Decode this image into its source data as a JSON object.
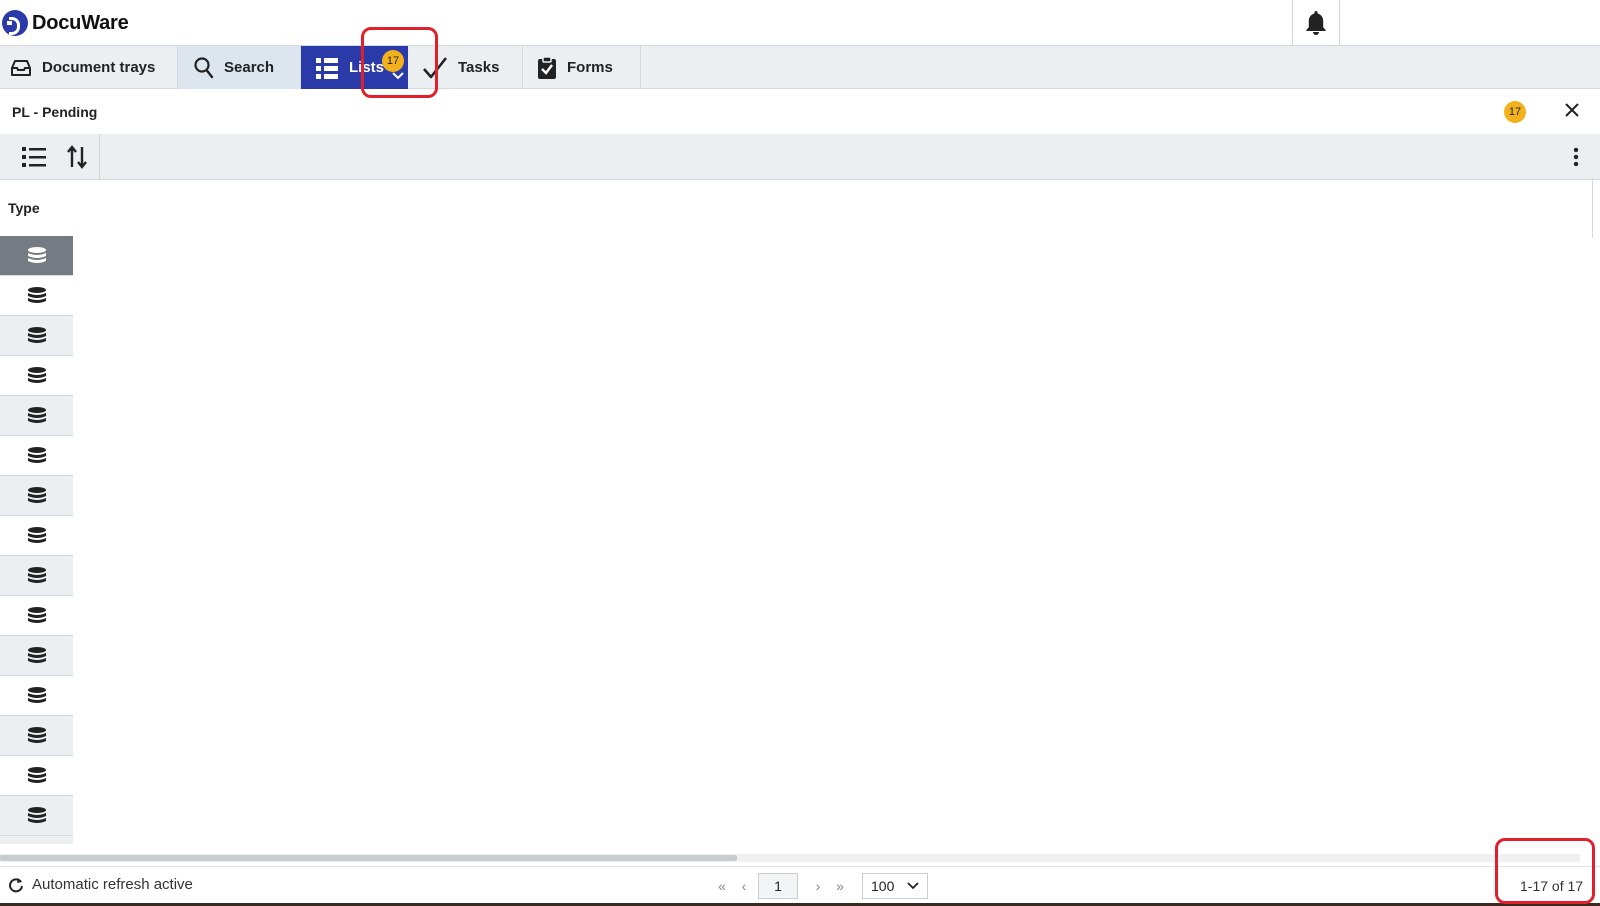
{
  "app": {
    "logo_text": "DocuWare"
  },
  "header": {
    "bell_icon": "bell-icon"
  },
  "nav": {
    "items": [
      {
        "label": "Document trays",
        "icon": "inbox-tray-icon"
      },
      {
        "label": "Search",
        "icon": "search-icon"
      },
      {
        "label": "Lists",
        "icon": "list-grid-icon",
        "badge": "17",
        "active": true
      },
      {
        "label": "Tasks",
        "icon": "check-icon"
      },
      {
        "label": "Forms",
        "icon": "clipboard-check-icon"
      }
    ],
    "window_icon": "window-layout-icon"
  },
  "panel": {
    "title": "PL - Pending",
    "badge": "17",
    "close_icon": "close-icon"
  },
  "toolbar": {
    "list_view_icon": "list-view-icon",
    "sort_icon": "sort-icon",
    "more_icon": "more-vertical-icon"
  },
  "grid": {
    "columns": [
      {
        "label": "Type"
      }
    ],
    "row_icon": "database-icon",
    "row_count": 15,
    "selected_row": 0
  },
  "footer": {
    "refresh_label": "Automatic refresh active",
    "page": "1",
    "page_size": "100",
    "count": "1-17 of 17"
  },
  "colors": {
    "accent": "#2a3aa8",
    "badge": "#f3b21b",
    "highlight": "#e0202a",
    "selected_row": "#757b82"
  }
}
